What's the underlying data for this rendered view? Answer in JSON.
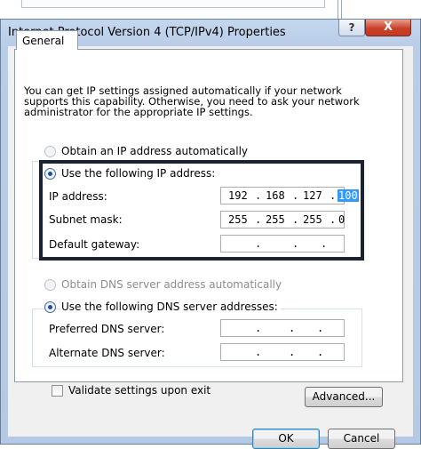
{
  "window": {
    "title": "Internet Protocol Version 4 (TCP/IPv4) Properties",
    "help_glyph": "?",
    "close_glyph": "X"
  },
  "tabs": [
    {
      "label": "General"
    }
  ],
  "intro_text": "You can get IP settings assigned automatically if your network supports this capability. Otherwise, you need to ask your network administrator for the appropriate IP settings.",
  "ip_section": {
    "auto_label": "Obtain an IP address automatically",
    "manual_label": "Use the following IP address:",
    "selected": "manual",
    "fields": [
      {
        "label": "IP address:",
        "octets": [
          "192",
          "168",
          "127",
          "100"
        ],
        "highlighted_octet": 3
      },
      {
        "label": "Subnet mask:",
        "octets": [
          "255",
          "255",
          "255",
          "0"
        ]
      },
      {
        "label": "Default gateway:",
        "octets": [
          "",
          "",
          "",
          ""
        ]
      }
    ]
  },
  "dns_section": {
    "auto_label": "Obtain DNS server address automatically",
    "manual_label": "Use the following DNS server addresses:",
    "selected": "manual",
    "fields": [
      {
        "label": "Preferred DNS server:",
        "octets": [
          "",
          "",
          "",
          ""
        ]
      },
      {
        "label": "Alternate DNS server:",
        "octets": [
          "",
          "",
          "",
          ""
        ]
      }
    ]
  },
  "validate_label": "Validate settings upon exit",
  "validate_checked": false,
  "buttons": {
    "advanced": "Advanced...",
    "ok": "OK",
    "cancel": "Cancel"
  }
}
